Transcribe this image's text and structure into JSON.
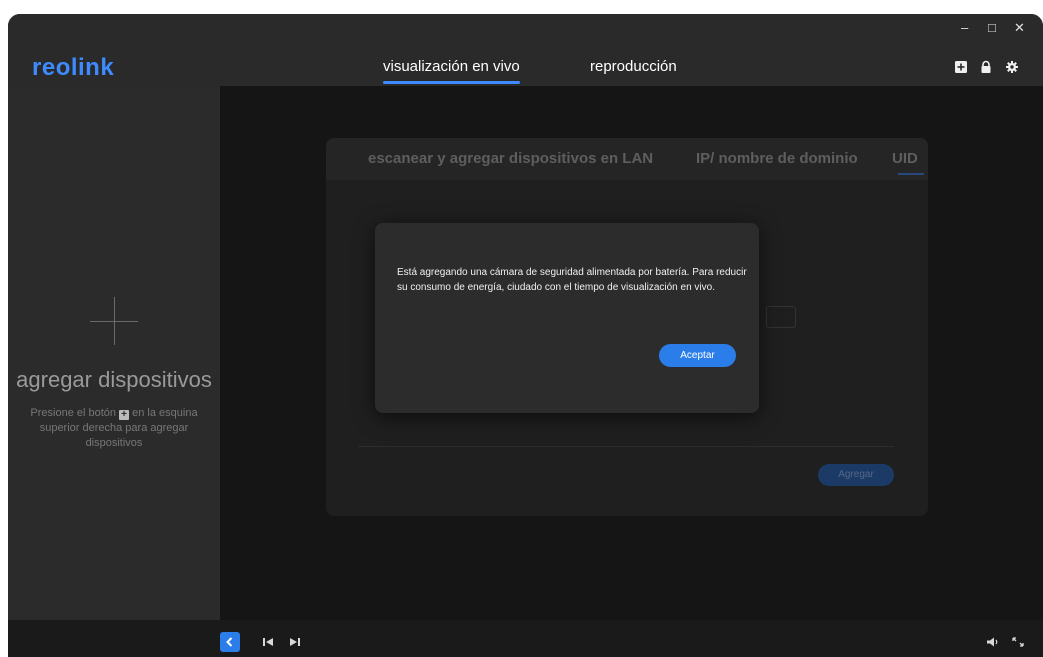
{
  "app": {
    "logo": "reolink",
    "accent_color": "#2b7de9",
    "window_controls": {
      "minimize": "–",
      "maximize": "□",
      "close": "✕"
    }
  },
  "nav": {
    "tabs": [
      {
        "label": "visualización en vivo",
        "active": true
      },
      {
        "label": "reproducción",
        "active": false
      }
    ]
  },
  "toolbar_icons": [
    "add-device-icon",
    "lock-icon",
    "settings-gear-icon"
  ],
  "sidebar": {
    "title": "agregar dispositivos",
    "desc_before": "Presione el botón",
    "desc_after": "en la esquina superior derecha para agregar dispositivos"
  },
  "add_panel": {
    "tabs": [
      {
        "label": "escanear y agregar dispositivos en LAN"
      },
      {
        "label": "IP/ nombre de dominio"
      },
      {
        "label": "UID",
        "active": true
      }
    ],
    "add_button": "Agregar"
  },
  "modal": {
    "message": "Está agregando una cámara de seguridad alimentada por batería. Para reducir su consumo de energía, ciudado con el tiempo de visualización en vivo.",
    "accept_button": "Aceptar"
  },
  "bottom_icons": [
    "collapse-left-icon",
    "previous-icon",
    "next-icon",
    "volume-icon",
    "fullscreen-icon"
  ]
}
